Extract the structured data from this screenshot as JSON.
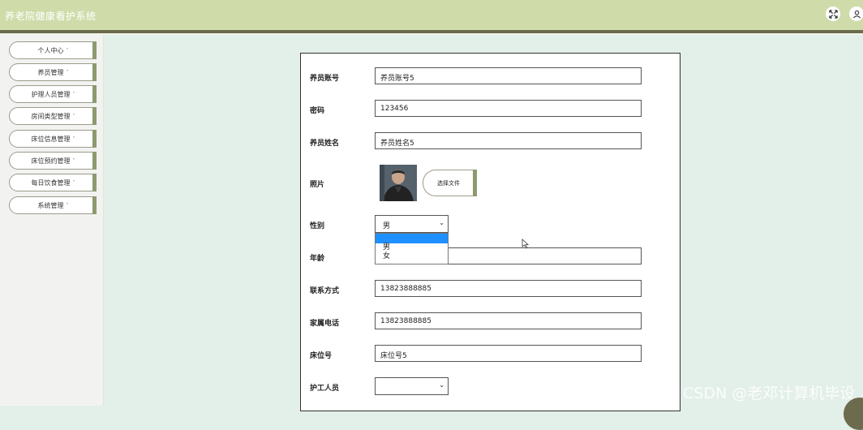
{
  "app": {
    "title": "养老院健康看护系统"
  },
  "header": {
    "fullscreen_icon": "expand-arrows-icon",
    "user_icon": "user-icon"
  },
  "sidebar": {
    "items": [
      {
        "label": "个人中心"
      },
      {
        "label": "养员管理"
      },
      {
        "label": "护理人员管理"
      },
      {
        "label": "房间类型管理"
      },
      {
        "label": "床位信息管理"
      },
      {
        "label": "床位预约管理"
      },
      {
        "label": "每日饮食管理"
      },
      {
        "label": "系统管理"
      }
    ],
    "caret": "˅"
  },
  "form": {
    "account": {
      "label": "养员账号",
      "value": "养员账号5"
    },
    "password": {
      "label": "密码",
      "value": "123456"
    },
    "name": {
      "label": "养员姓名",
      "value": "养员姓名5"
    },
    "photo": {
      "label": "照片",
      "button": "选择文件"
    },
    "gender": {
      "label": "性别",
      "selected": "男",
      "options": [
        "男",
        "女"
      ]
    },
    "age": {
      "label": "年龄",
      "value": ""
    },
    "contact": {
      "label": "联系方式",
      "value": "13823888885"
    },
    "family_phone": {
      "label": "家属电话",
      "value": "13823888885"
    },
    "bed_no": {
      "label": "床位号",
      "value": "床位号5"
    },
    "caregiver": {
      "label": "护工人员",
      "selected": ""
    }
  },
  "watermark": "CSDN @老邓计算机毕设"
}
